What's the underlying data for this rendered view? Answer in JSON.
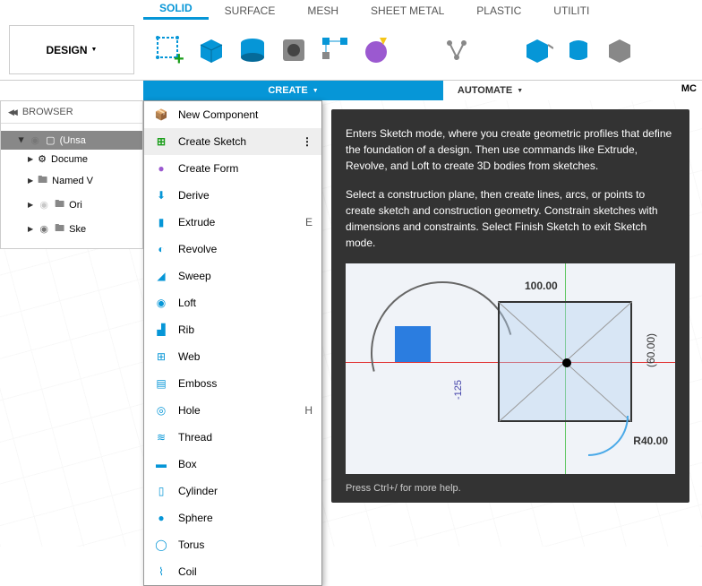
{
  "ribbon": {
    "tabs": [
      "SOLID",
      "SURFACE",
      "MESH",
      "SHEET METAL",
      "PLASTIC",
      "UTILITI"
    ],
    "active_tab": 0,
    "design_label": "DESIGN",
    "create_label": "CREATE",
    "automate_label": "AUTOMATE",
    "mc_label": "MC"
  },
  "browser": {
    "header": "BROWSER",
    "items": [
      {
        "label": "(Unsa",
        "type": "root"
      },
      {
        "label": "Docume",
        "icon": "gear"
      },
      {
        "label": "Named V",
        "icon": "folder"
      },
      {
        "label": "Ori",
        "icon": "folder",
        "hidden": true
      },
      {
        "label": "Ske",
        "icon": "folder"
      }
    ]
  },
  "create_menu": {
    "items": [
      {
        "label": "New Component",
        "icon": "new-component"
      },
      {
        "label": "Create Sketch",
        "icon": "sketch",
        "highlighted": true
      },
      {
        "label": "Create Form",
        "icon": "form"
      },
      {
        "label": "Derive",
        "icon": "derive"
      },
      {
        "label": "Extrude",
        "icon": "extrude",
        "shortcut": "E"
      },
      {
        "label": "Revolve",
        "icon": "revolve"
      },
      {
        "label": "Sweep",
        "icon": "sweep"
      },
      {
        "label": "Loft",
        "icon": "loft"
      },
      {
        "label": "Rib",
        "icon": "rib"
      },
      {
        "label": "Web",
        "icon": "web"
      },
      {
        "label": "Emboss",
        "icon": "emboss"
      },
      {
        "label": "Hole",
        "icon": "hole",
        "shortcut": "H"
      },
      {
        "label": "Thread",
        "icon": "thread"
      },
      {
        "label": "Box",
        "icon": "box"
      },
      {
        "label": "Cylinder",
        "icon": "cylinder"
      },
      {
        "label": "Sphere",
        "icon": "sphere"
      },
      {
        "label": "Torus",
        "icon": "torus"
      },
      {
        "label": "Coil",
        "icon": "coil"
      }
    ]
  },
  "tooltip": {
    "para1": "Enters Sketch mode, where you create geometric profiles that define the foundation of a design. Then use commands like Extrude, Revolve, and Loft to create 3D bodies from sketches.",
    "para2": "Select a construction plane, then create lines, arcs, or points to create sketch and construction geometry. Constrain sketches with dimensions and constraints. Select Finish Sketch to exit Sketch mode.",
    "footer": "Press Ctrl+/ for more help.",
    "dims": {
      "top": "100.00",
      "right": "(60.00)",
      "radius": "R40.00",
      "left": "-125"
    }
  }
}
